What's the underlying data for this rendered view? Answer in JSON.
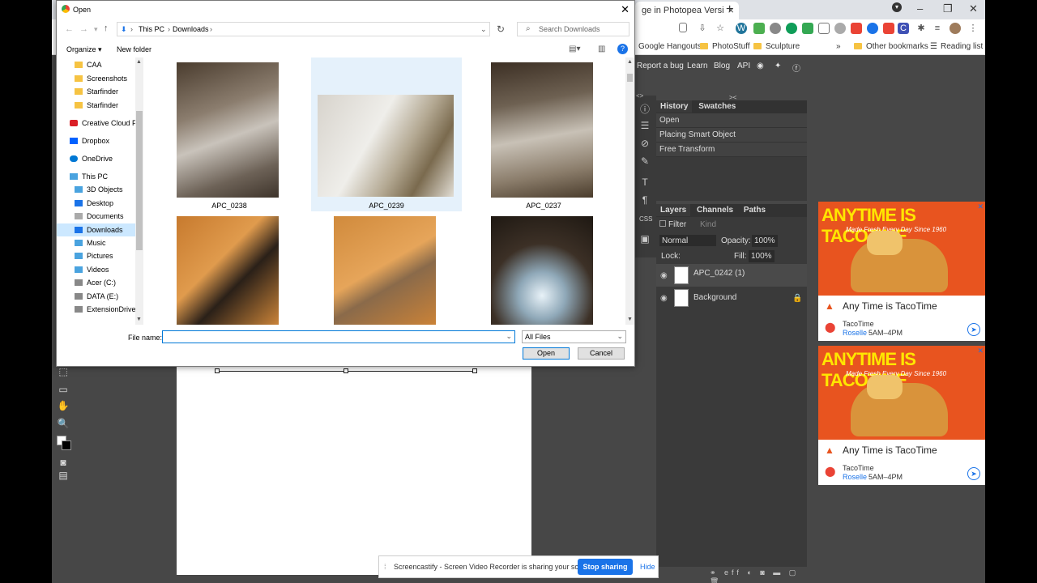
{
  "browser": {
    "tab_title": "ge in Photopea Versi",
    "new_tab": "+",
    "bookmarks": [
      "Google Hangouts",
      "PhotoStuff",
      "Sculpture"
    ],
    "more_bookmarks": "»",
    "other_bookmarks": "Other bookmarks",
    "reading_list": "Reading list"
  },
  "photopea": {
    "menu_links": [
      "Report a bug",
      "Learn",
      "Blog",
      "API"
    ],
    "history_tabs": [
      "History",
      "Swatches"
    ],
    "history_items": [
      "Open",
      "Placing Smart Object",
      "Free Transform"
    ],
    "layer_tabs": [
      "Layers",
      "Channels",
      "Paths"
    ],
    "filter_label": "Filter",
    "kind_label": "Kind",
    "blend_mode": "Normal",
    "opacity_label": "Opacity:",
    "opacity_value": "100%",
    "lock_label": "Lock:",
    "fill_label": "Fill:",
    "fill_value": "100%",
    "layers": [
      "APC_0242 (1)",
      "Background"
    ]
  },
  "ads": [
    {
      "headline": "ANYTIME IS TACOTIME",
      "tagline": "Made Fresh Every Day Since 1960",
      "title": "Any Time is TacoTime",
      "brand": "TacoTime",
      "location": "Roselle",
      "hours": "5AM–4PM"
    },
    {
      "headline": "ANYTIME IS TACOTIME",
      "tagline": "Made Fresh Every Day Since 1960",
      "title": "Any Time is TacoTime",
      "brand": "TacoTime",
      "location": "Roselle",
      "hours": "5AM–4PM"
    }
  ],
  "dialog": {
    "title": "Open",
    "path": [
      "This PC",
      "Downloads"
    ],
    "search_placeholder": "Search Downloads",
    "organize": "Organize ▾",
    "new_folder": "New folder",
    "nav_items": [
      "CAA",
      "Screenshots",
      "Starfinder",
      "Starfinder",
      "Creative Cloud Fil",
      "Dropbox",
      "OneDrive",
      "This PC",
      "3D Objects",
      "Desktop",
      "Documents",
      "Downloads",
      "Music",
      "Pictures",
      "Videos",
      "Acer (C:)",
      "DATA (E:)",
      "ExtensionDrive ("
    ],
    "files": [
      "APC_0238",
      "APC_0239",
      "APC_0237"
    ],
    "file_name_label": "File name:",
    "file_name_value": "",
    "file_type": "All Files",
    "open_button": "Open",
    "cancel_button": "Cancel"
  },
  "screencastify": {
    "message": "Screencastify - Screen Video Recorder is sharing your screen.",
    "stop": "Stop sharing",
    "hide": "Hide"
  }
}
